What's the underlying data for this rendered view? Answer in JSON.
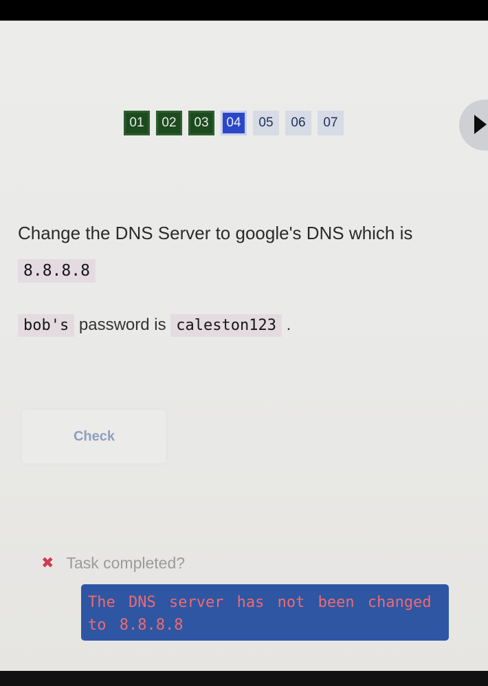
{
  "stepper": {
    "steps": [
      {
        "label": "01",
        "state": "done"
      },
      {
        "label": "02",
        "state": "done"
      },
      {
        "label": "03",
        "state": "done"
      },
      {
        "label": "04",
        "state": "active"
      },
      {
        "label": "05",
        "state": "todo"
      },
      {
        "label": "06",
        "state": "todo"
      },
      {
        "label": "07",
        "state": "todo"
      }
    ],
    "next_icon": "play-arrow-icon"
  },
  "task": {
    "question_text": "Change the DNS Server to google's DNS which is",
    "dns_value": "8.8.8.8",
    "hint_user": "bob's",
    "hint_middle": "password is",
    "hint_password": "caleston123",
    "hint_end": "."
  },
  "check": {
    "label": "Check"
  },
  "status": {
    "icon": "cross-icon",
    "label": "Task completed?",
    "message": "The DNS server has not been changed to 8.8.8.8"
  },
  "colors": {
    "done_step": "#1d4a1f",
    "active_step": "#2b47c8",
    "todo_step": "#d7dbe6",
    "error_icon": "#ce3a53",
    "message_bg": "#2e56a3",
    "message_text": "#f06a70"
  }
}
